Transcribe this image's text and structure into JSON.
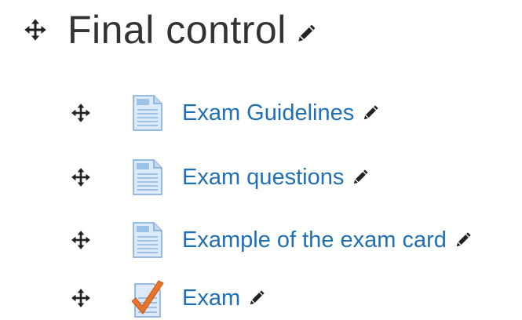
{
  "section": {
    "title": "Final control",
    "move_icon": "move-icon",
    "edit_icon": "pencil-icon"
  },
  "activities": [
    {
      "label": "Exam Guidelines",
      "icon": "file-icon"
    },
    {
      "label": "Exam questions",
      "icon": "file-icon"
    },
    {
      "label": "Example of the exam card",
      "icon": "file-icon"
    },
    {
      "label": "Exam",
      "icon": "quiz-checkmark-icon"
    }
  ],
  "colors": {
    "title": "#333333",
    "link": "#1f6fb5",
    "icon_dark": "#222222",
    "file_blue": "#9cc2e8",
    "check_orange": "#e8742a"
  }
}
